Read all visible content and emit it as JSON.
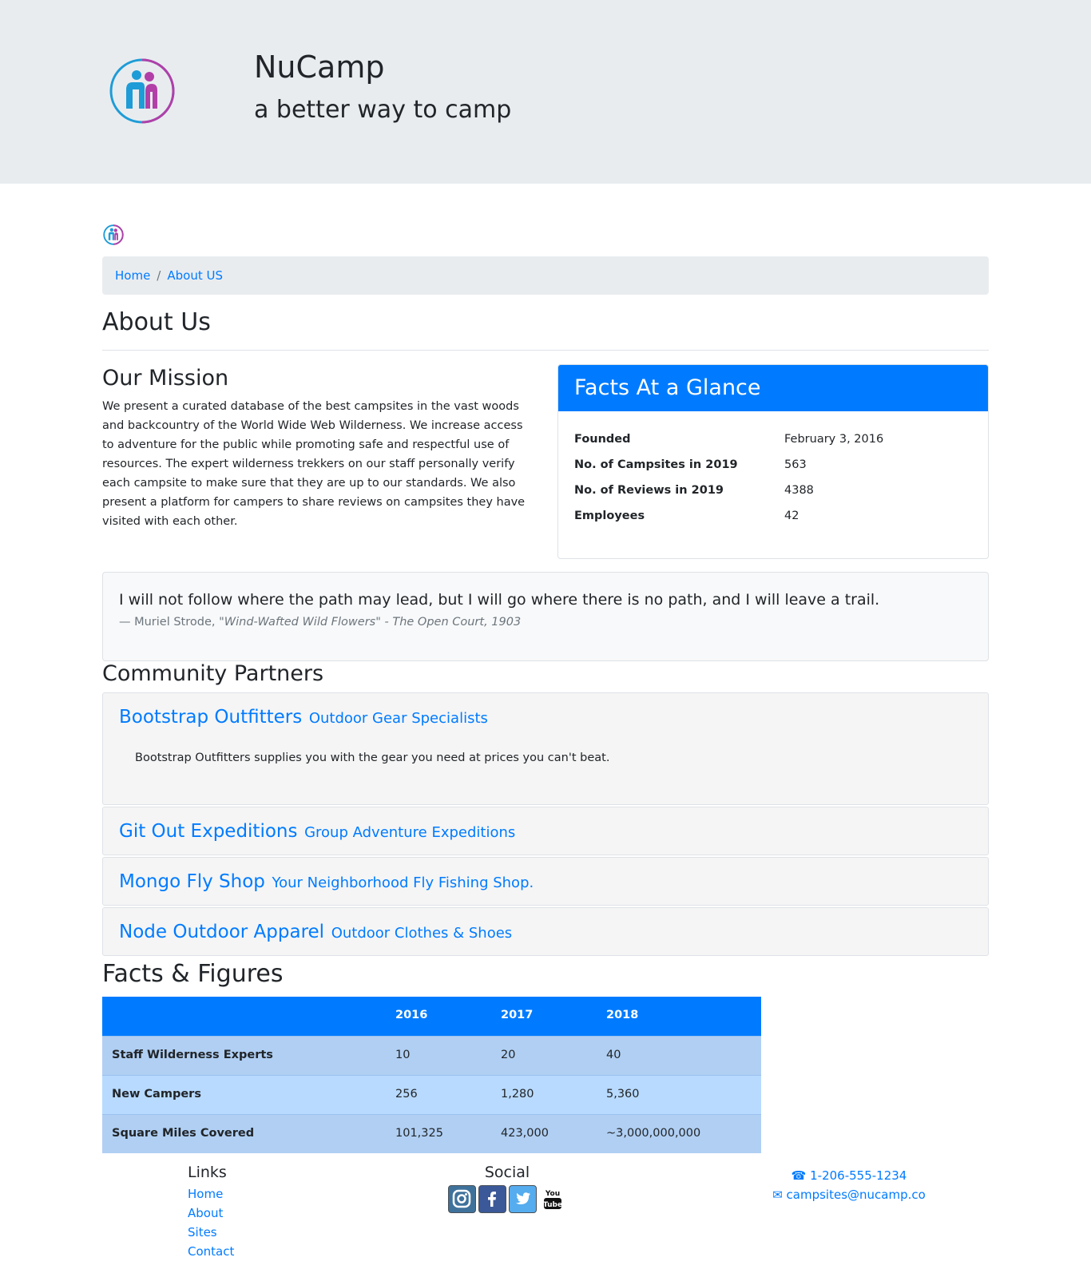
{
  "header": {
    "title": "NuCamp",
    "subtitle": "a better way to camp"
  },
  "breadcrumb": {
    "home": "Home",
    "separator": "/",
    "current": "About US"
  },
  "page_title": "About Us",
  "mission": {
    "heading": "Our Mission",
    "text": "We present a curated database of the best campsites in the vast woods and backcountry of the World Wide Web Wilderness. We increase access to adventure for the public while promoting safe and respectful use of resources. The expert wilderness trekkers on our staff personally verify each campsite to make sure that they are up to our standards. We also present a platform for campers to share reviews on campsites they have visited with each other."
  },
  "facts": {
    "heading": "Facts At a Glance",
    "rows": [
      {
        "label": "Founded",
        "value": "February 3, 2016"
      },
      {
        "label": "No. of Campsites in 2019",
        "value": "563"
      },
      {
        "label": "No. of Reviews in 2019",
        "value": "4388"
      },
      {
        "label": "Employees",
        "value": "42"
      }
    ]
  },
  "quote": {
    "text": "I will not follow where the path may lead, but I will go where there is no path, and I will leave a trail.",
    "author": "— Muriel Strode, ",
    "source": "\"Wind-Wafted Wild Flowers\" - The Open Court, 1903"
  },
  "partners": {
    "heading": "Community Partners",
    "items": [
      {
        "name": "Bootstrap Outfitters",
        "tagline": "Outdoor Gear Specialists",
        "description": "Bootstrap Outfitters supplies you with the gear you need at prices you can't beat."
      },
      {
        "name": "Git Out Expeditions",
        "tagline": "Group Adventure Expeditions"
      },
      {
        "name": "Mongo Fly Shop",
        "tagline": "Your Neighborhood Fly Fishing Shop."
      },
      {
        "name": "Node Outdoor Apparel",
        "tagline": "Outdoor Clothes & Shoes"
      }
    ]
  },
  "figures": {
    "heading": "Facts & Figures",
    "columns": [
      "",
      "2016",
      "2017",
      "2018"
    ],
    "rows": [
      [
        "Staff Wilderness Experts",
        "10",
        "20",
        "40"
      ],
      [
        "New Campers",
        "256",
        "1,280",
        "5,360"
      ],
      [
        "Square Miles Covered",
        "101,325",
        "423,000",
        "~3,000,000,000"
      ]
    ]
  },
  "footer": {
    "links_heading": "Links",
    "links": [
      "Home",
      "About",
      "Sites",
      "Contact"
    ],
    "social_heading": "Social",
    "social_icons": [
      "instagram-icon",
      "facebook-icon",
      "twitter-icon",
      "youtube-icon"
    ],
    "youtube_text_1": "You",
    "youtube_text_2": "Tube",
    "phone": "1-206-555-1234",
    "email": "campsites@nucamp.co"
  },
  "colors": {
    "primary": "#007bff",
    "jumbotron_bg": "#e9ecef",
    "table_row_odd": "#b0cff3",
    "table_row_even": "#b8daff",
    "instagram": "#3f729b",
    "facebook": "#3b5998",
    "twitter": "#55acee"
  }
}
